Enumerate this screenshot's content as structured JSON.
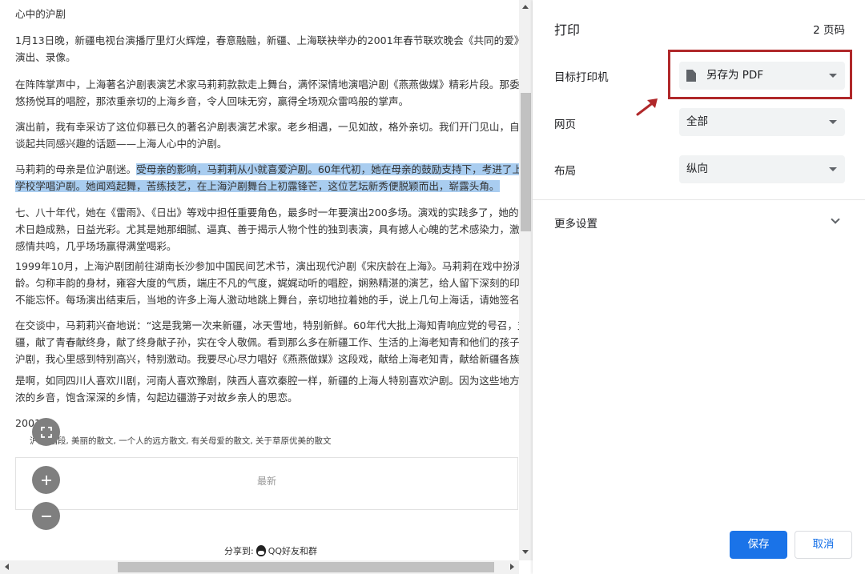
{
  "preview": {
    "title": "心中的沪剧",
    "paragraphs": [
      [
        "1月13日晚，新疆电视台演播厅里灯火辉煌，春意融融，新疆、上海联袂举办的2001年春节联欢晚会《共同的爱》正在这",
        "演出、录像。"
      ],
      [
        "在阵阵掌声中，上海著名沪剧表演艺术家马莉莉款款走上舞台，满怀深情地演唱沪剧《燕燕做媒》精彩片段。那委婉甜润",
        "悠扬悦耳的唱腔，那浓重亲切的上海乡音，令人回味无穷，赢得全场观众雷鸣般的掌声。"
      ],
      [
        "演出前，我有幸采访了这位仰慕已久的著名沪剧表演艺术家。老乡相遇，一见如故，格外亲切。我们开门见山，自然而然",
        "谈起共同感兴趣的话题——上海人心中的沪剧。"
      ]
    ],
    "highlight_para": {
      "line1_pre": "马莉莉的母亲是位沪剧迷。",
      "line1_hl": "受母亲的影响，马莉莉从小就喜爱沪剧。60年代初，她在母亲的鼓励支持下，考进了上海戏剧",
      "line2_hl": "学校学唱沪剧。她闻鸡起舞，苦练技艺，在上海沪剧舞台上初露锋芒，这位艺坛新秀便脱颖而出，崭露头角。"
    },
    "paragraphs2": [
      [
        "七、八十年代，她在《雷雨》、《日出》等戏中担任重要角色，最多时一年要演出200多场。演戏的实践多了，她的表演",
        "术日趋成熟，日益光彩。尤其是她那细腻、逼真、善于揭示人物个性的独到表演，具有撼人心魄的艺术感染力，激起观众",
        "感情共鸣，几乎场场赢得满堂喝彩。"
      ],
      [
        "1999年10月，上海沪剧团前往湖南长沙参加中国民间艺术节，演出现代沪剧《宋庆龄在上海》。马莉莉在戏中扮演宋庆",
        "龄。匀称丰韵的身材，雍容大度的气质，端庄不凡的气度，娓娓动听的唱腔，娴熟精湛的演艺，给人留下深刻的印象，久",
        "不能忘怀。每场演出结束后，当地的许多上海人激动地跳上舞台，亲切地拉着她的手，说上几句上海话，请她签名、合影"
      ],
      [
        "在交谈中，马莉莉兴奋地说：“这是我第一次来新疆，冰天雪地，特别新鲜。60年代大批上海知青响应党的号召，支边到新",
        "疆，献了青春献终身，献了终身献子孙，实在令人敬佩。看到那么多在新疆工作、生活的上海老知青和他们的孩子十分喜",
        "沪剧，我心里感到特别高兴，特别激动。我要尽心尽力唱好《燕燕做媒》这段戏，献给上海老知青，献给新疆各族人民。"
      ],
      [
        "是啊，如同四川人喜欢川剧，河南人喜欢豫剧，陕西人喜欢秦腔一样，新疆的上海人特别喜欢沪剧。因为这些地方戏带着",
        "浓的乡音，饱含深深的乡情，勾起边疆游子对故乡亲人的思恋。"
      ]
    ],
    "date_partial": "2001",
    "tags_text": "沪剧 唱段, 美丽的散文, 一个人的远方散文, 有关母爱的散文, 关于草原优美的散文",
    "latest_label": "最新",
    "share_label": "分享到:",
    "share_target": "QQ好友和群"
  },
  "settings": {
    "title": "打印",
    "page_count": "2 页码",
    "destination_label": "目标打印机",
    "destination_value": "另存为 PDF",
    "pages_label": "网页",
    "pages_value": "全部",
    "layout_label": "布局",
    "layout_value": "纵向",
    "more_settings_label": "更多设置",
    "save_button": "保存",
    "cancel_button": "取消"
  },
  "colors": {
    "primary": "#1a73e8",
    "annotation_red": "#b0282a",
    "highlight": "#a9cdf0"
  },
  "icons": [
    "fullscreen-icon",
    "zoom-in-icon",
    "zoom-out-icon",
    "qq-icon",
    "file-icon",
    "chevron-down-icon",
    "dropdown-caret-icon"
  ]
}
